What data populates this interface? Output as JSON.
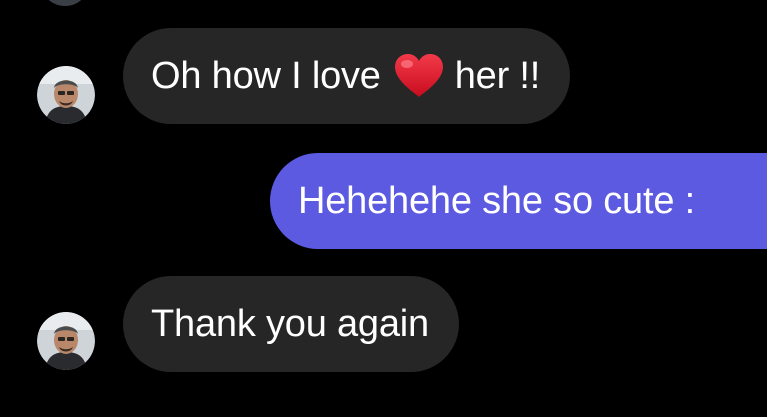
{
  "conversation": {
    "messages": [
      {
        "direction": "incoming",
        "text_before": "Oh how I love",
        "emoji": "red-heart",
        "text_after": "her !!",
        "show_avatar": true
      },
      {
        "direction": "outgoing",
        "text": "Hehehehe she so cute :",
        "show_avatar": false
      },
      {
        "direction": "incoming",
        "text": "Thank you again",
        "show_avatar": true
      }
    ]
  },
  "colors": {
    "background": "#000000",
    "incoming_bubble": "#262626",
    "outgoing_bubble": "#5c5ae0",
    "message_text": "#ffffff",
    "heart": "#e0122a"
  },
  "icons": {
    "heart": "red-heart-icon",
    "avatar": "user-avatar-photo"
  }
}
